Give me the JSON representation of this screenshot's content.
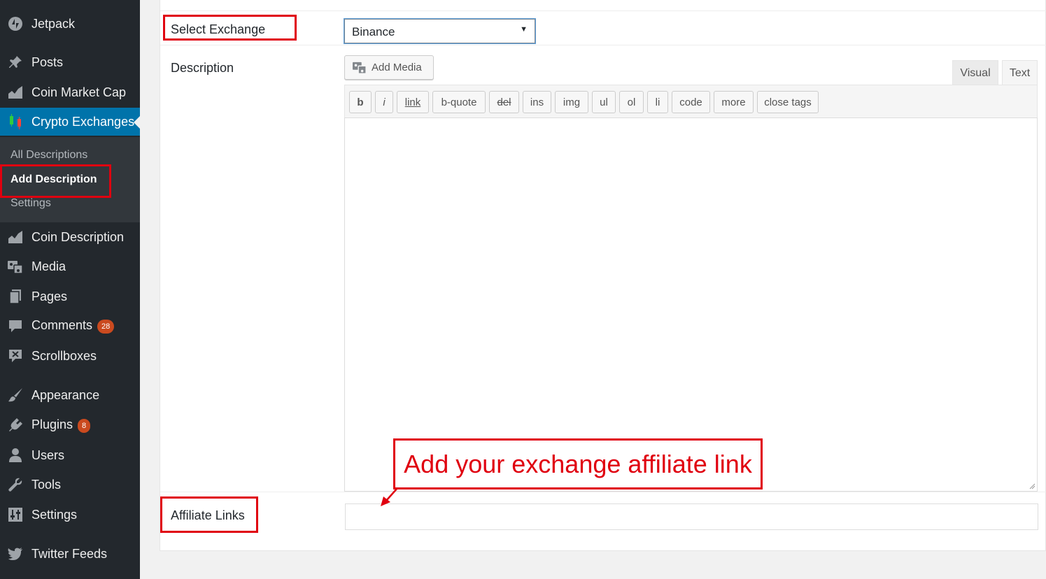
{
  "sidebar": {
    "items": [
      {
        "label": "Jetpack",
        "icon": "jetpack-icon"
      },
      {
        "label": "Posts",
        "icon": "pin-icon"
      },
      {
        "label": "Coin Market Cap",
        "icon": "chart-area-icon"
      },
      {
        "label": "Crypto Exchanges",
        "icon": "candlestick-icon"
      },
      {
        "label": "Coin Description",
        "icon": "chart-area-icon"
      },
      {
        "label": "Media",
        "icon": "media-icon"
      },
      {
        "label": "Pages",
        "icon": "pages-icon"
      },
      {
        "label": "Comments",
        "icon": "comment-icon",
        "badge": "28"
      },
      {
        "label": "Scrollboxes",
        "icon": "scrollbox-icon"
      },
      {
        "label": "Appearance",
        "icon": "brush-icon"
      },
      {
        "label": "Plugins",
        "icon": "plugin-icon",
        "badge": "8"
      },
      {
        "label": "Users",
        "icon": "user-icon"
      },
      {
        "label": "Tools",
        "icon": "wrench-icon"
      },
      {
        "label": "Settings",
        "icon": "settings-icon"
      },
      {
        "label": "Twitter Feeds",
        "icon": "twitter-icon"
      }
    ],
    "submenu": [
      "All Descriptions",
      "Add Description",
      "Settings"
    ]
  },
  "form": {
    "select_label": "Select Exchange",
    "select_value": "Binance",
    "description_label": "Description",
    "add_media": "Add Media",
    "tab_visual": "Visual",
    "tab_text": "Text",
    "quicktags": [
      "b",
      "i",
      "link",
      "b-quote",
      "del",
      "ins",
      "img",
      "ul",
      "ol",
      "li",
      "code",
      "more",
      "close tags"
    ],
    "affiliate_label": "Affiliate Links",
    "affiliate_value": ""
  },
  "annotation": {
    "callout_text": "Add your exchange affiliate link"
  },
  "colors": {
    "sidebar_bg": "#23282d",
    "submenu_bg": "#32373c",
    "accent": "#0073aa",
    "badge": "#ca4a1f",
    "annotation_red": "#e0000f"
  }
}
